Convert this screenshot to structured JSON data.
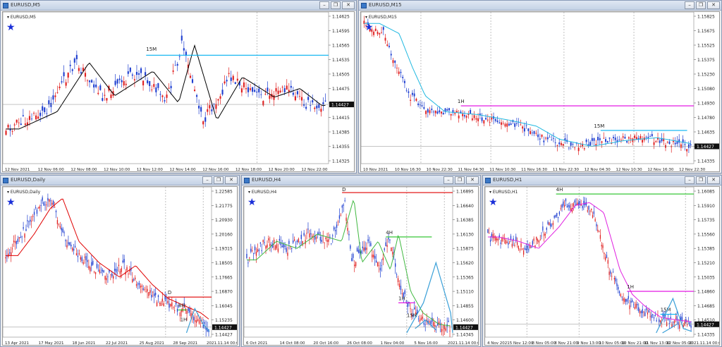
{
  "windows": [
    {
      "id": "eurusd-m5",
      "title": "EURUSD,M5",
      "symbol_label": "EURUSD,M5",
      "price_axis": [
        "1.14625",
        "1.14595",
        "1.14565",
        "1.14535",
        "1.14505",
        "1.14475",
        "1.14445",
        "1.14415",
        "1.14385",
        "1.14355",
        "1.14325"
      ],
      "time_axis": [
        "12 Nov 2021",
        "12 Nov 06:00",
        "12 Nov 08:00",
        "12 Nov 10:00",
        "12 Nov 12:00",
        "12 Nov 14:00",
        "12 Nov 16:00",
        "12 Nov 18:00",
        "12 Nov 20:00",
        "12 Nov 22:00"
      ],
      "current_price": "1.14427",
      "annotations": [
        "15M"
      ],
      "colors": {
        "ma": "#000000",
        "level": "#00b0f0"
      }
    },
    {
      "id": "eurusd-m15",
      "title": "EURUSD,M15",
      "symbol_label": "EURUSD,M15",
      "price_axis": [
        "1.15825",
        "1.15675",
        "1.15525",
        "1.15375",
        "1.15230",
        "1.15080",
        "1.14930",
        "1.14780",
        "1.14635",
        "1.14485",
        "1.14335"
      ],
      "time_axis": [
        "10 Nov 2021",
        "10 Nov 16:30",
        "10 Nov 22:30",
        "11 Nov 04:30",
        "11 Nov 10:30",
        "11 Nov 16:30",
        "11 Nov 22:30",
        "12 Nov 04:30",
        "12 Nov 10:30",
        "12 Nov 16:30",
        "12 Nov 22:30"
      ],
      "current_price": "1.14427",
      "annotations": [
        "1H",
        "15M"
      ],
      "colors": {
        "ma": "#20b8e0",
        "level_1h": "#e000e0",
        "level_15m": "#00b0f0"
      }
    },
    {
      "id": "eurusd-daily",
      "title": "EURUSD,Daily",
      "symbol_label": "EURUSD,Daily",
      "price_axis": [
        "1.22585",
        "1.21775",
        "1.20930",
        "1.20160",
        "1.19315",
        "1.18505",
        "1.17665",
        "1.16870",
        "1.16045",
        "1.15235",
        "1.14427"
      ],
      "time_axis": [
        "13 Apr 2021",
        "17 May 2021",
        "18 Jun 2021",
        "22 Jul 2021",
        "25 Aug 2021",
        "28 Sep 2021",
        "2021.11.14 00:00"
      ],
      "current_price": "1.14427",
      "annotations": [
        "D",
        "4H",
        "1H"
      ],
      "colors": {
        "ma": "#e00000",
        "level_d": "#e00000",
        "level_4h": "#20c020"
      }
    },
    {
      "id": "eurusd-h4",
      "title": "EURUSD,H4",
      "symbol_label": "EURUSD,H4",
      "price_axis": [
        "1.16895",
        "1.16640",
        "1.16385",
        "1.16130",
        "1.15875",
        "1.15620",
        "1.15365",
        "1.15110",
        "1.14855",
        "1.14600",
        "1.14345"
      ],
      "time_axis": [
        "6 Oct 2021",
        "14 Oct 08:00",
        "20 Oct 16:00",
        "26 Oct 08:00",
        "1 Nov 04:00",
        "5 Nov 16:00",
        "2021.11.14 00:00"
      ],
      "current_price": "1.14427",
      "annotations": [
        "D",
        "4H",
        "1H",
        "15M"
      ],
      "colors": {
        "ma": "#40b840",
        "level_d": "#e00000",
        "level_4h": "#20c020",
        "level_1h": "#e000e0"
      }
    },
    {
      "id": "eurusd-h1",
      "title": "EURUSD,H1",
      "symbol_label": "EURUSD,H1",
      "price_axis": [
        "1.16085",
        "1.15910",
        "1.15735",
        "1.15560",
        "1.15385",
        "1.15210",
        "1.15035",
        "1.14860",
        "1.14685",
        "1.14510",
        "1.14335"
      ],
      "time_axis": [
        "4 Nov 2021",
        "5 Nov 12:00",
        "8 Nov 05:00",
        "8 Nov 21:00",
        "9 Nov 13:00",
        "10 Nov 05:00",
        "10 Nov 21:00",
        "11 Nov 13:00",
        "12 Nov 05:00",
        "2021.11.14 00:00"
      ],
      "current_price": "1.14427",
      "annotations": [
        "4H",
        "1H",
        "15M"
      ],
      "colors": {
        "ma": "#e020e0",
        "level_4h": "#20c020",
        "level_1h": "#e000e0",
        "level_15m": "#00b0f0"
      }
    }
  ],
  "window_buttons": {
    "minimize": "–",
    "restore": "❐",
    "close": "✕"
  },
  "icons": {
    "star": "star-icon",
    "window": "window-icon"
  }
}
